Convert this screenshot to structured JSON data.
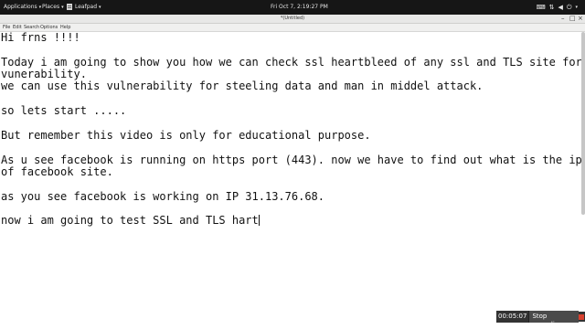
{
  "topbar": {
    "applications": "Applications",
    "places": "Places",
    "app_name": "Leafpad",
    "clock": "Fri Oct 7, 2:19:27 PM",
    "tray_icons": [
      "keyboard-icon",
      "network-icon",
      "volume-icon",
      "power-icon"
    ]
  },
  "window": {
    "title": "*(Untitled)",
    "buttons": [
      "minimize",
      "maximize",
      "close"
    ]
  },
  "menu": [
    "File",
    "Edit",
    "Search",
    "Options",
    "Help"
  ],
  "editor": {
    "lines": [
      "Hi frns !!!!",
      "",
      "Today i am going to show you how we can check ssl heartbleed of any ssl and TLS site for",
      "vunerability.",
      "we can use this vulnerability for steeling data and man in middel attack.",
      "",
      "so lets start .....",
      "",
      "But remember this video is only for educational purpose.",
      "",
      "As u see facebook is running on https port (443). now we have to find out what is the ip ad",
      "of facebook site.",
      "",
      "as you see facebook is working on IP 31.13.76.68.",
      "",
      "now i am going to test SSL and TLS hart"
    ]
  },
  "recording": {
    "timer": "00:05:07",
    "label": "Stop recording"
  }
}
